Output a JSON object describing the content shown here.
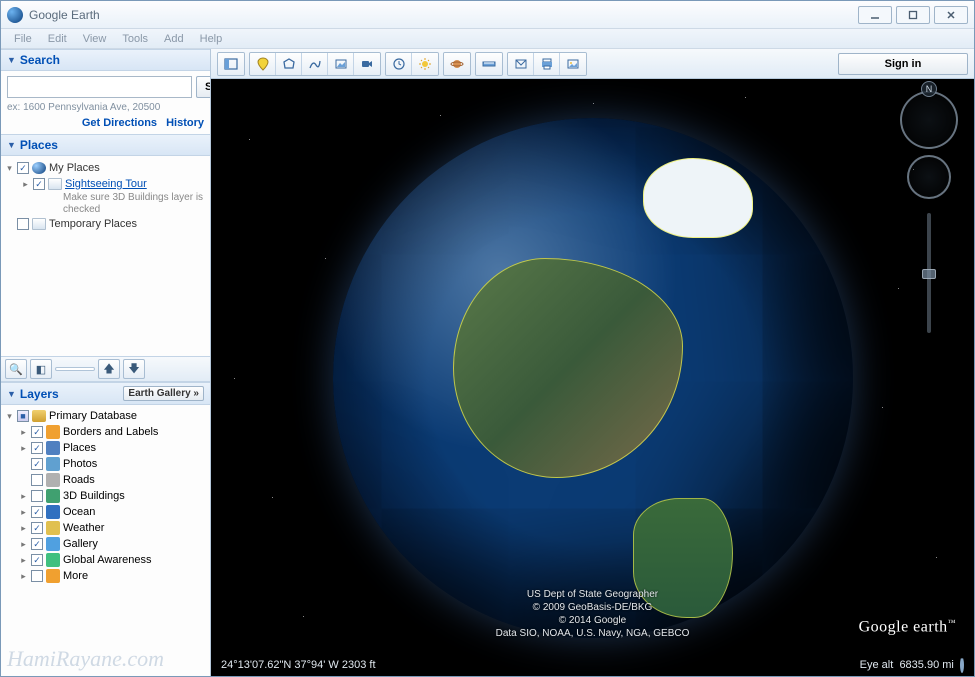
{
  "window": {
    "title": "Google Earth"
  },
  "menu": [
    "File",
    "Edit",
    "View",
    "Tools",
    "Add",
    "Help"
  ],
  "sidebar": {
    "search": {
      "title": "Search",
      "button": "Search",
      "hint": "ex: 1600 Pennsylvania Ave, 20500",
      "link_directions": "Get Directions",
      "link_history": "History"
    },
    "places": {
      "title": "Places",
      "items": [
        {
          "label": "My Places",
          "checked": true,
          "icon": "globe",
          "expandable": true,
          "expanded": true,
          "link": false,
          "indent": 0
        },
        {
          "label": "Sightseeing Tour",
          "checked": true,
          "icon": "folder",
          "expandable": true,
          "expanded": false,
          "link": true,
          "indent": 1,
          "sub": "Make sure 3D Buildings layer is checked"
        },
        {
          "label": "Temporary Places",
          "checked": false,
          "icon": "folder",
          "expandable": false,
          "link": false,
          "indent": 0
        }
      ]
    },
    "layers": {
      "title": "Layers",
      "gallery": "Earth Gallery »",
      "root": "Primary Database",
      "items": [
        {
          "label": "Borders and Labels",
          "checked": true,
          "color": "#f0a030",
          "expandable": true
        },
        {
          "label": "Places",
          "checked": true,
          "color": "#5080c0",
          "expandable": true
        },
        {
          "label": "Photos",
          "checked": true,
          "color": "#60a0d0",
          "expandable": false
        },
        {
          "label": "Roads",
          "checked": false,
          "color": "#b0b0b0",
          "expandable": false
        },
        {
          "label": "3D Buildings",
          "checked": false,
          "color": "#40a070",
          "expandable": true
        },
        {
          "label": "Ocean",
          "checked": true,
          "color": "#3070c0",
          "expandable": true
        },
        {
          "label": "Weather",
          "checked": true,
          "color": "#e0c050",
          "expandable": true
        },
        {
          "label": "Gallery",
          "checked": true,
          "color": "#50a0e0",
          "expandable": true
        },
        {
          "label": "Global Awareness",
          "checked": true,
          "color": "#40c080",
          "expandable": true
        },
        {
          "label": "More",
          "checked": false,
          "color": "#f0a030",
          "expandable": true
        }
      ]
    }
  },
  "toolbar": {
    "icons": [
      "hide-sidebar-icon",
      "placemark-icon",
      "polygon-icon",
      "path-icon",
      "image-overlay-icon",
      "record-tour-icon",
      "historical-imagery-icon",
      "sunlight-icon",
      "planets-icon",
      "ruler-icon",
      "email-icon",
      "print-icon",
      "save-image-icon"
    ],
    "signin": "Sign in"
  },
  "viewport": {
    "attribution": [
      "US Dept of State Geographer",
      "© 2009 GeoBasis-DE/BKG",
      "© 2014 Google",
      "Data SIO, NOAA, U.S. Navy, NGA, GEBCO"
    ],
    "brand": "Google earth",
    "north": "N",
    "status_coords": "24°13'07.62\"N  37°94' W  2303 ft",
    "status_alt_label": "Eye alt",
    "status_alt_value": "6835.90 mi"
  },
  "watermark": "HamiRayane.com"
}
